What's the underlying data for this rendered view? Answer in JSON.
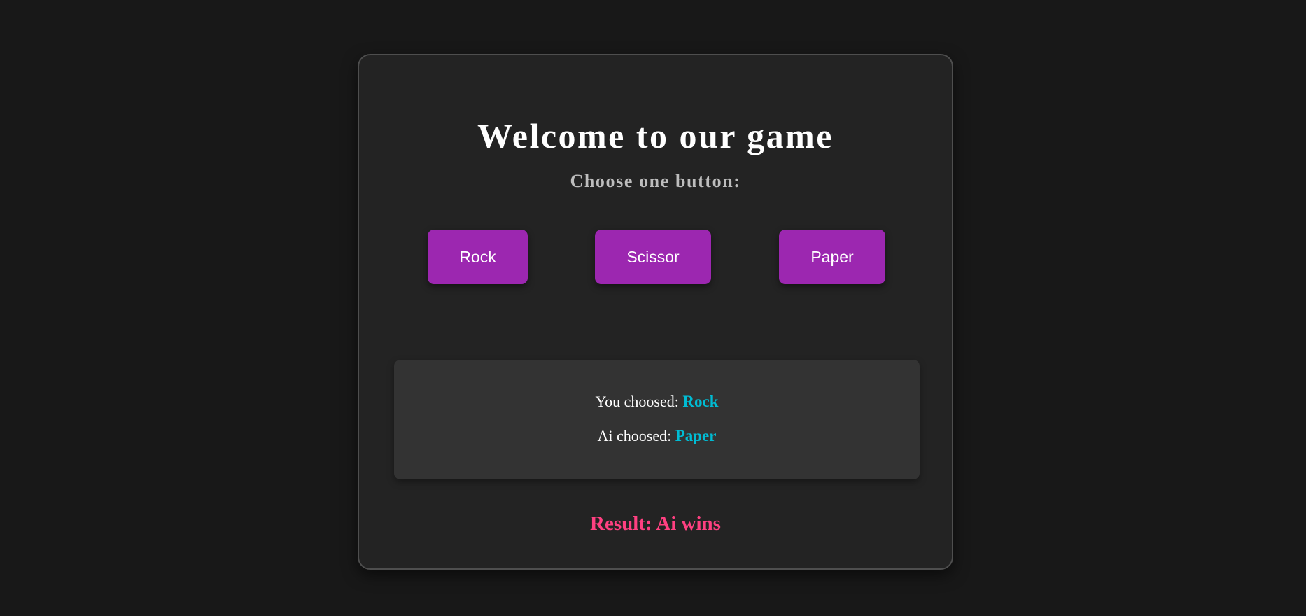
{
  "header": {
    "title": "Welcome to our game",
    "subtitle": "Choose one button:"
  },
  "buttons": {
    "rock": "Rock",
    "scissor": "Scissor",
    "paper": "Paper"
  },
  "choices": {
    "user_label": "You choosed:",
    "user_value": "Rock",
    "ai_label": "Ai choosed:",
    "ai_value": "Paper"
  },
  "result": {
    "text": "Result: Ai wins"
  },
  "colors": {
    "background": "#181818",
    "card": "#232323",
    "panel": "#333333",
    "button": "#9c27b0",
    "choice_value": "#00bcd4",
    "result": "#ff4081"
  }
}
